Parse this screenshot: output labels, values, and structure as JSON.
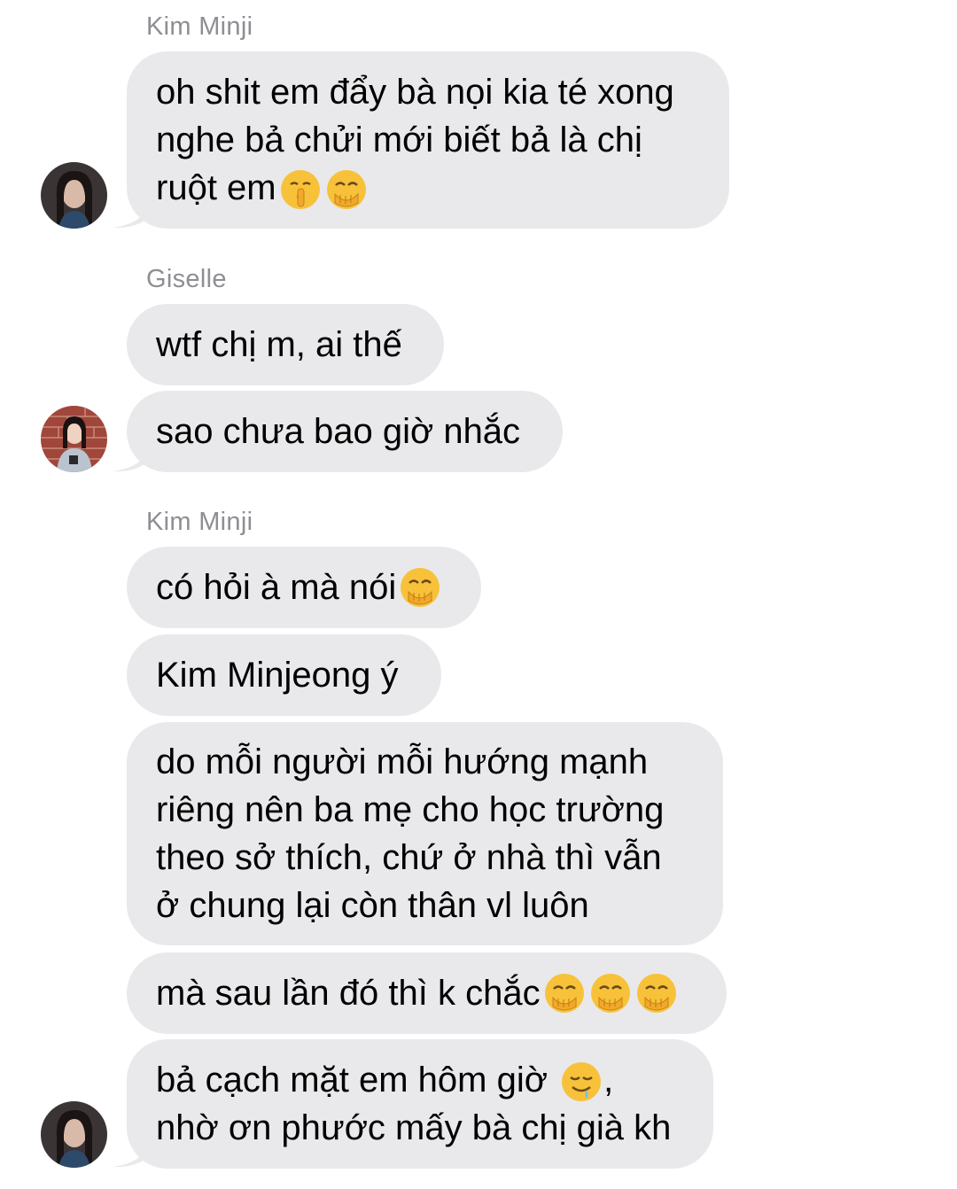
{
  "colors": {
    "bubble": "#e9e9eb",
    "sender": "#8e8e93",
    "text": "#000000",
    "emoji_face": "#f7c23a"
  },
  "groups": [
    {
      "sender": "Kim Minji",
      "messages": [
        {
          "lines": [
            "oh shit em đẩy bà nọi kia té xong",
            "nghe bả chửi mới biết bả là chị",
            "ruột em"
          ],
          "emojis": [
            "shushing-face-emoji",
            "hand-over-mouth-emoji"
          ]
        }
      ]
    },
    {
      "sender": "Giselle",
      "messages": [
        {
          "lines": [
            "wtf chị m, ai thế"
          ]
        },
        {
          "lines": [
            "sao chưa bao giờ nhắc"
          ]
        }
      ]
    },
    {
      "sender": "Kim Minji",
      "messages": [
        {
          "lines": [
            "có hỏi à mà nói"
          ],
          "emojis": [
            "hand-over-mouth-emoji"
          ]
        },
        {
          "lines": [
            "Kim Minjeong ý"
          ]
        },
        {
          "lines": [
            "do mỗi người mỗi hướng mạnh",
            "riêng nên ba mẹ cho học trường",
            "theo sở thích, chứ ở nhà thì vẫn",
            "ở chung lại còn thân vl luôn"
          ]
        },
        {
          "lines": [
            "mà sau lần đó thì k chắc"
          ],
          "emojis": [
            "hand-over-mouth-emoji",
            "hand-over-mouth-emoji",
            "hand-over-mouth-emoji"
          ]
        },
        {
          "lines": [
            "bả cạch mặt em hôm giờ ",
            "nhờ ơn phước mấy bà chị già kh"
          ],
          "emojis": [
            "drooling-face-emoji"
          ]
        }
      ]
    }
  ]
}
